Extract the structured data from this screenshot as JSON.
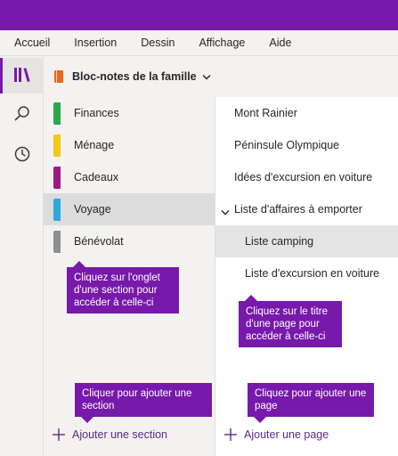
{
  "menubar": {
    "items": [
      "Accueil",
      "Insertion",
      "Dessin",
      "Affichage",
      "Aide"
    ]
  },
  "notebook": {
    "title": "Bloc-notes de la famille",
    "icon": "notebook-icon",
    "color": "#e8681c"
  },
  "rail": {
    "items": [
      "notebooks-icon",
      "search-icon",
      "recent-clock-icon"
    ]
  },
  "sections": {
    "items": [
      {
        "label": "Finances",
        "color": "#2aa84a"
      },
      {
        "label": "Ménage",
        "color": "#f2c811"
      },
      {
        "label": "Cadeaux",
        "color": "#a01a7d"
      },
      {
        "label": "Voyage",
        "color": "#2ea8d9",
        "selected": true
      },
      {
        "label": "Bénévolat",
        "color": "#8f8f8f"
      }
    ],
    "add_label": "Ajouter une section"
  },
  "pages": {
    "items": [
      {
        "label": "Mont Rainier"
      },
      {
        "label": "Péninsule Olympique"
      },
      {
        "label": "Idées d'excursion en voiture"
      },
      {
        "label": "Liste d'affaires à emporter",
        "expanded": true
      },
      {
        "label": "Liste camping",
        "selected": true
      },
      {
        "label": "Liste d'excursion en voiture"
      }
    ],
    "add_label": "Ajouter une page"
  },
  "callouts": {
    "section_tab": "Cliquez sur l'onglet d'une section pour accéder à celle-ci",
    "page_title": "Cliquez sur le titre d'une page pour accéder à celle-ci",
    "add_section": "Cliquer pour ajouter une section",
    "add_page": "Cliquez pour ajouter une page"
  },
  "colors": {
    "accent": "#7719aa"
  }
}
